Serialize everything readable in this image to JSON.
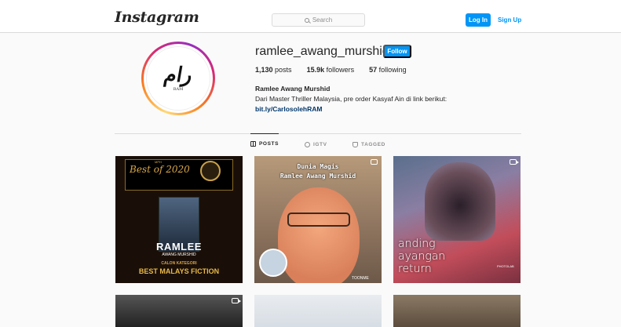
{
  "header": {
    "logo": "Instagram",
    "search_placeholder": "Search",
    "login_label": "Log In",
    "signup_label": "Sign Up"
  },
  "profile": {
    "username": "ramlee_awang_murshid",
    "follow_label": "Follow",
    "avatar_text": "RAM",
    "stats": {
      "posts_count": "1,130",
      "posts_label": "posts",
      "followers_count": "15.9k",
      "followers_label": "followers",
      "following_count": "57",
      "following_label": "following"
    },
    "full_name": "Ramlee Awang Murshid",
    "bio": "Dari Master Thriller Malaysia, pre order Kasyaf Ain di link berikut:",
    "link": "bit.ly/CarlosolehRAM"
  },
  "tabs": [
    {
      "label": "POSTS",
      "icon": "grid-icon",
      "active": true
    },
    {
      "label": "IGTV",
      "icon": "igtv-icon",
      "active": false
    },
    {
      "label": "TAGGED",
      "icon": "tagged-icon",
      "active": false
    }
  ],
  "posts": [
    {
      "best_of": "Best of 2020",
      "award": "MPH",
      "title": "RAMLEE",
      "subtitle": "AWANG MURSHID",
      "category": "CALON KATEGORI",
      "fiction": "BEST MALAYS FICTION"
    },
    {
      "line1": "Dunia Magis",
      "line2": "Ramlee Awang Murshid",
      "watermark": "TOONME",
      "icon": "multi-image-icon"
    },
    {
      "line1": "anding",
      "line2": "ayangan",
      "line3": "return",
      "watermark": "PHOTOLAB",
      "icon": "video-icon"
    }
  ],
  "colors": {
    "accent": "#0095f6",
    "link": "#00376b",
    "text": "#262626",
    "muted": "#8e8e8e",
    "background": "#fafafa"
  }
}
